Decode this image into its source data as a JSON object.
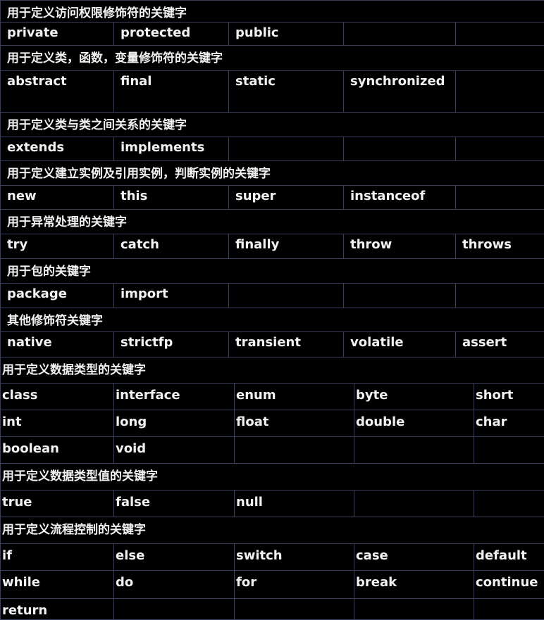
{
  "top_sections": [
    {
      "title": "用于定义访问权限修饰符的关键字",
      "rows": [
        [
          "private",
          "protected",
          "public",
          "",
          ""
        ]
      ]
    },
    {
      "title": "用于定义类，函数，变量修饰符的关键字",
      "rows": [
        [
          "abstract",
          "final",
          "static",
          "synchronized",
          ""
        ]
      ]
    },
    {
      "title": "用于定义类与类之间关系的关键字",
      "rows": [
        [
          "extends",
          "implements",
          "",
          "",
          ""
        ]
      ]
    },
    {
      "title": "用于定义建立实例及引用实例，判断实例的关键字",
      "rows": [
        [
          "new",
          "this",
          "super",
          "instanceof",
          ""
        ]
      ]
    },
    {
      "title": "用于异常处理的关键字",
      "rows": [
        [
          "try",
          "catch",
          "finally",
          "throw",
          "throws"
        ]
      ]
    },
    {
      "title": "用于包的关键字",
      "rows": [
        [
          "package",
          "import",
          "",
          "",
          ""
        ]
      ]
    },
    {
      "title": "其他修饰符关键字",
      "rows": [
        [
          "native",
          "strictfp",
          "transient",
          "volatile",
          "assert"
        ]
      ]
    }
  ],
  "bottom_sections": [
    {
      "title": "用于定义数据类型的关键字",
      "rows": [
        [
          "class",
          "interface",
          "enum",
          "byte",
          "short"
        ],
        [
          "int",
          "long",
          "float",
          "double",
          "char"
        ],
        [
          "boolean",
          "void",
          "",
          "",
          ""
        ]
      ]
    },
    {
      "title": "用于定义数据类型值的关键字",
      "rows": [
        [
          "true",
          "false",
          "null",
          "",
          ""
        ]
      ]
    },
    {
      "title": "用于定义流程控制的关键字",
      "rows": [
        [
          "if",
          "else",
          "switch",
          "case",
          "default"
        ],
        [
          "while",
          "do",
          "for",
          "break",
          "continue"
        ],
        [
          "return",
          "",
          "",
          "",
          ""
        ]
      ]
    }
  ]
}
